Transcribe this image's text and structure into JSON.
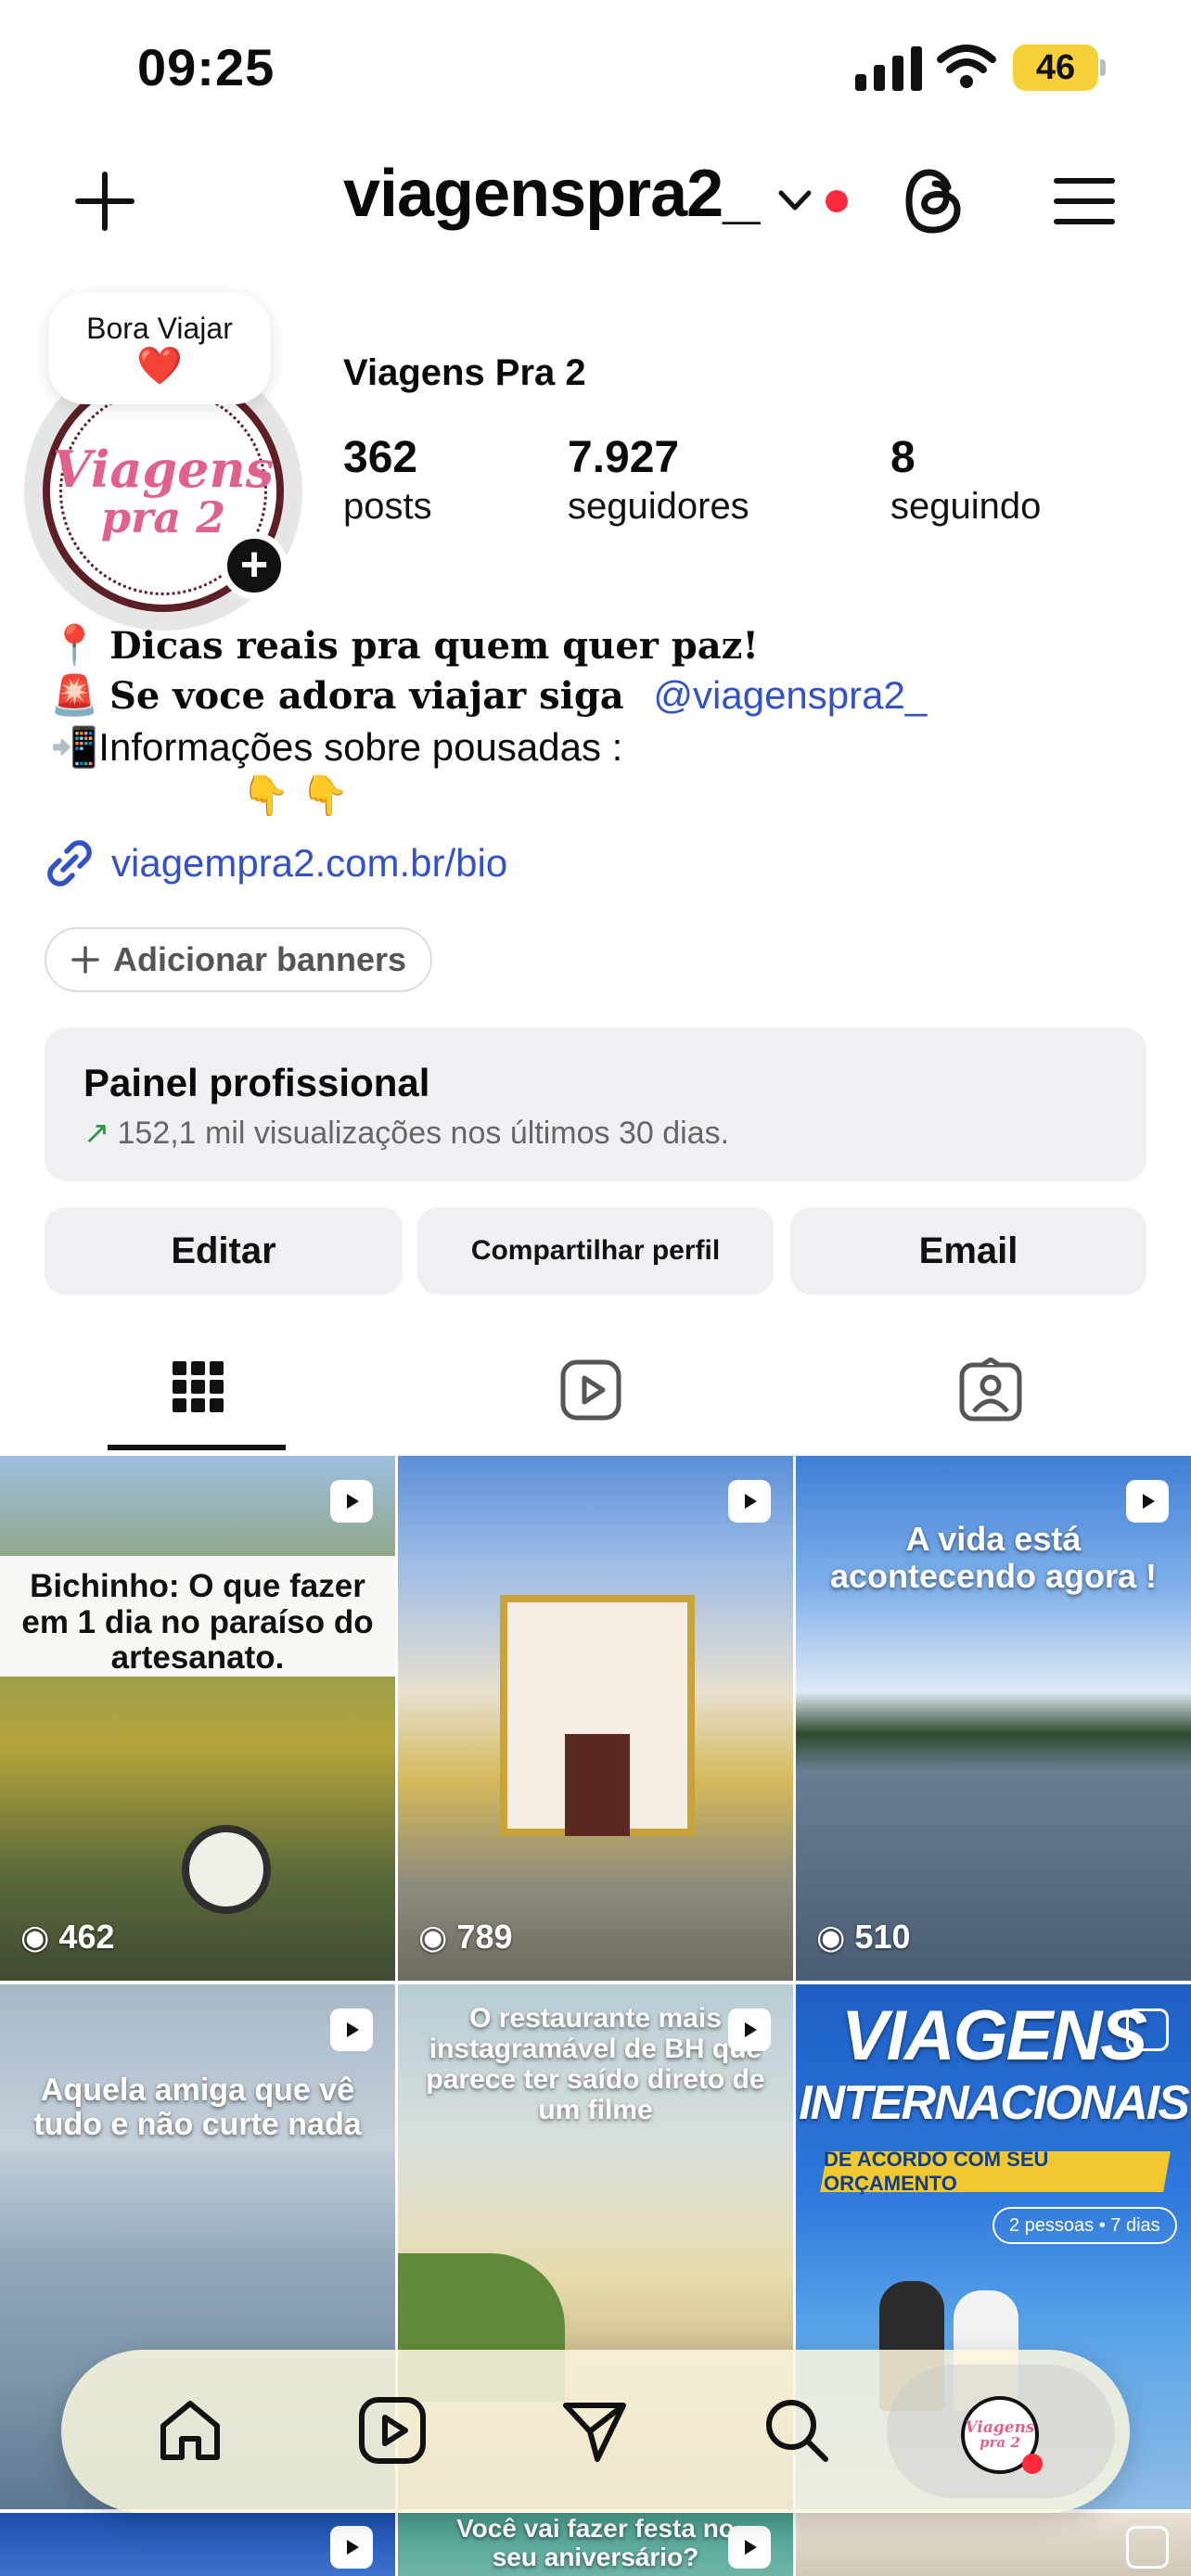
{
  "status": {
    "time": "09:25",
    "battery": "46"
  },
  "header": {
    "username": "viagenspra2_"
  },
  "note": {
    "text": "Bora Viajar",
    "emoji": "❤️"
  },
  "avatar": {
    "line1": "Viagens",
    "line2": "pra 2"
  },
  "profile": {
    "display_name": "Viagens Pra 2",
    "stats": [
      {
        "value": "362",
        "label": "posts"
      },
      {
        "value": "7.927",
        "label": "seguidores"
      },
      {
        "value": "8",
        "label": "seguindo"
      }
    ]
  },
  "bio": {
    "line1_emoji": "📍",
    "line1": "Dicas reais pra quem quer paz!",
    "line2_emoji": "🚨",
    "line2": "Se voce adora viajar siga",
    "line2_mention": "@viagenspra2_",
    "line3_emoji": "📲",
    "line3": "Informações sobre pousadas :",
    "line4": "👇 👇",
    "link": "viagempra2.com.br/bio"
  },
  "banners": {
    "label": "Adicionar banners"
  },
  "panel": {
    "title": "Painel profissional",
    "subtitle": "152,1 mil visualizações nos últimos 30 dias."
  },
  "actions": {
    "edit": "Editar",
    "share": "Compartilhar perfil",
    "email": "Email"
  },
  "tabs": [
    "grid-icon",
    "reels-icon",
    "tagged-icon"
  ],
  "grid": [
    {
      "caption": "Bichinho: O que fazer em 1 dia no paraíso do artesanato.",
      "views": "462"
    },
    {
      "caption": "",
      "views": "789"
    },
    {
      "caption": "A vida está acontecendo agora !",
      "views": "510"
    },
    {
      "caption": "Aquela amiga que vê tudo e não curte nada",
      "views": ""
    },
    {
      "caption": "O restaurante mais instagramável de BH que parece ter saído direto de um filme",
      "views": ""
    },
    {
      "title1": "VIAGENS",
      "title2": "INTERNACIONAIS",
      "ribbon": "DE ACORDO COM SEU ORÇAMENTO",
      "chip": "2 pessoas • 7 dias"
    },
    {
      "caption": ""
    },
    {
      "caption": "Você vai fazer festa no seu aniversário?"
    },
    {
      "caption": ""
    }
  ],
  "nav": [
    "home-icon",
    "reels-icon",
    "messages-icon",
    "search-icon",
    "profile-avatar"
  ],
  "nav_avatar": {
    "line1": "Viagens",
    "line2": "pra 2"
  },
  "colors": {
    "link": "#3452c7",
    "battery": "#f7d13a",
    "notification": "#ff2a3d"
  }
}
